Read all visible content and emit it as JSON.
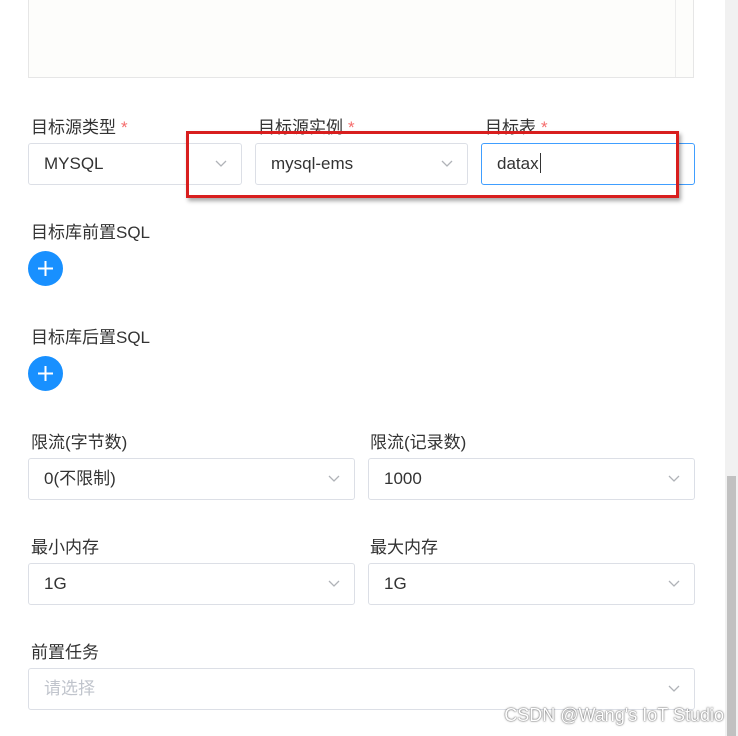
{
  "form": {
    "target_source_type": {
      "label": "目标源类型",
      "required_mark": "*",
      "value": "MYSQL"
    },
    "target_source_instance": {
      "label": "目标源实例",
      "required_mark": "*",
      "value": "mysql-ems"
    },
    "target_table": {
      "label": "目标表",
      "required_mark": "*",
      "value": "datax"
    },
    "pre_sql": {
      "label": "目标库前置SQL"
    },
    "post_sql": {
      "label": "目标库后置SQL"
    },
    "limit_bytes": {
      "label": "限流(字节数)",
      "value": "0(不限制)"
    },
    "limit_records": {
      "label": "限流(记录数)",
      "value": "1000"
    },
    "min_memory": {
      "label": "最小内存",
      "value": "1G"
    },
    "max_memory": {
      "label": "最大内存",
      "value": "1G"
    },
    "pre_task": {
      "label": "前置任务",
      "placeholder": "请选择"
    }
  },
  "icons": {
    "add": "plus-icon",
    "dropdown": "chevron-down-icon"
  },
  "colors": {
    "primary": "#1890ff",
    "required": "#f56c6c",
    "focus_border": "#409eff",
    "highlight_box": "#d81e1e"
  },
  "watermark": "CSDN @Wang's IoT Studio"
}
